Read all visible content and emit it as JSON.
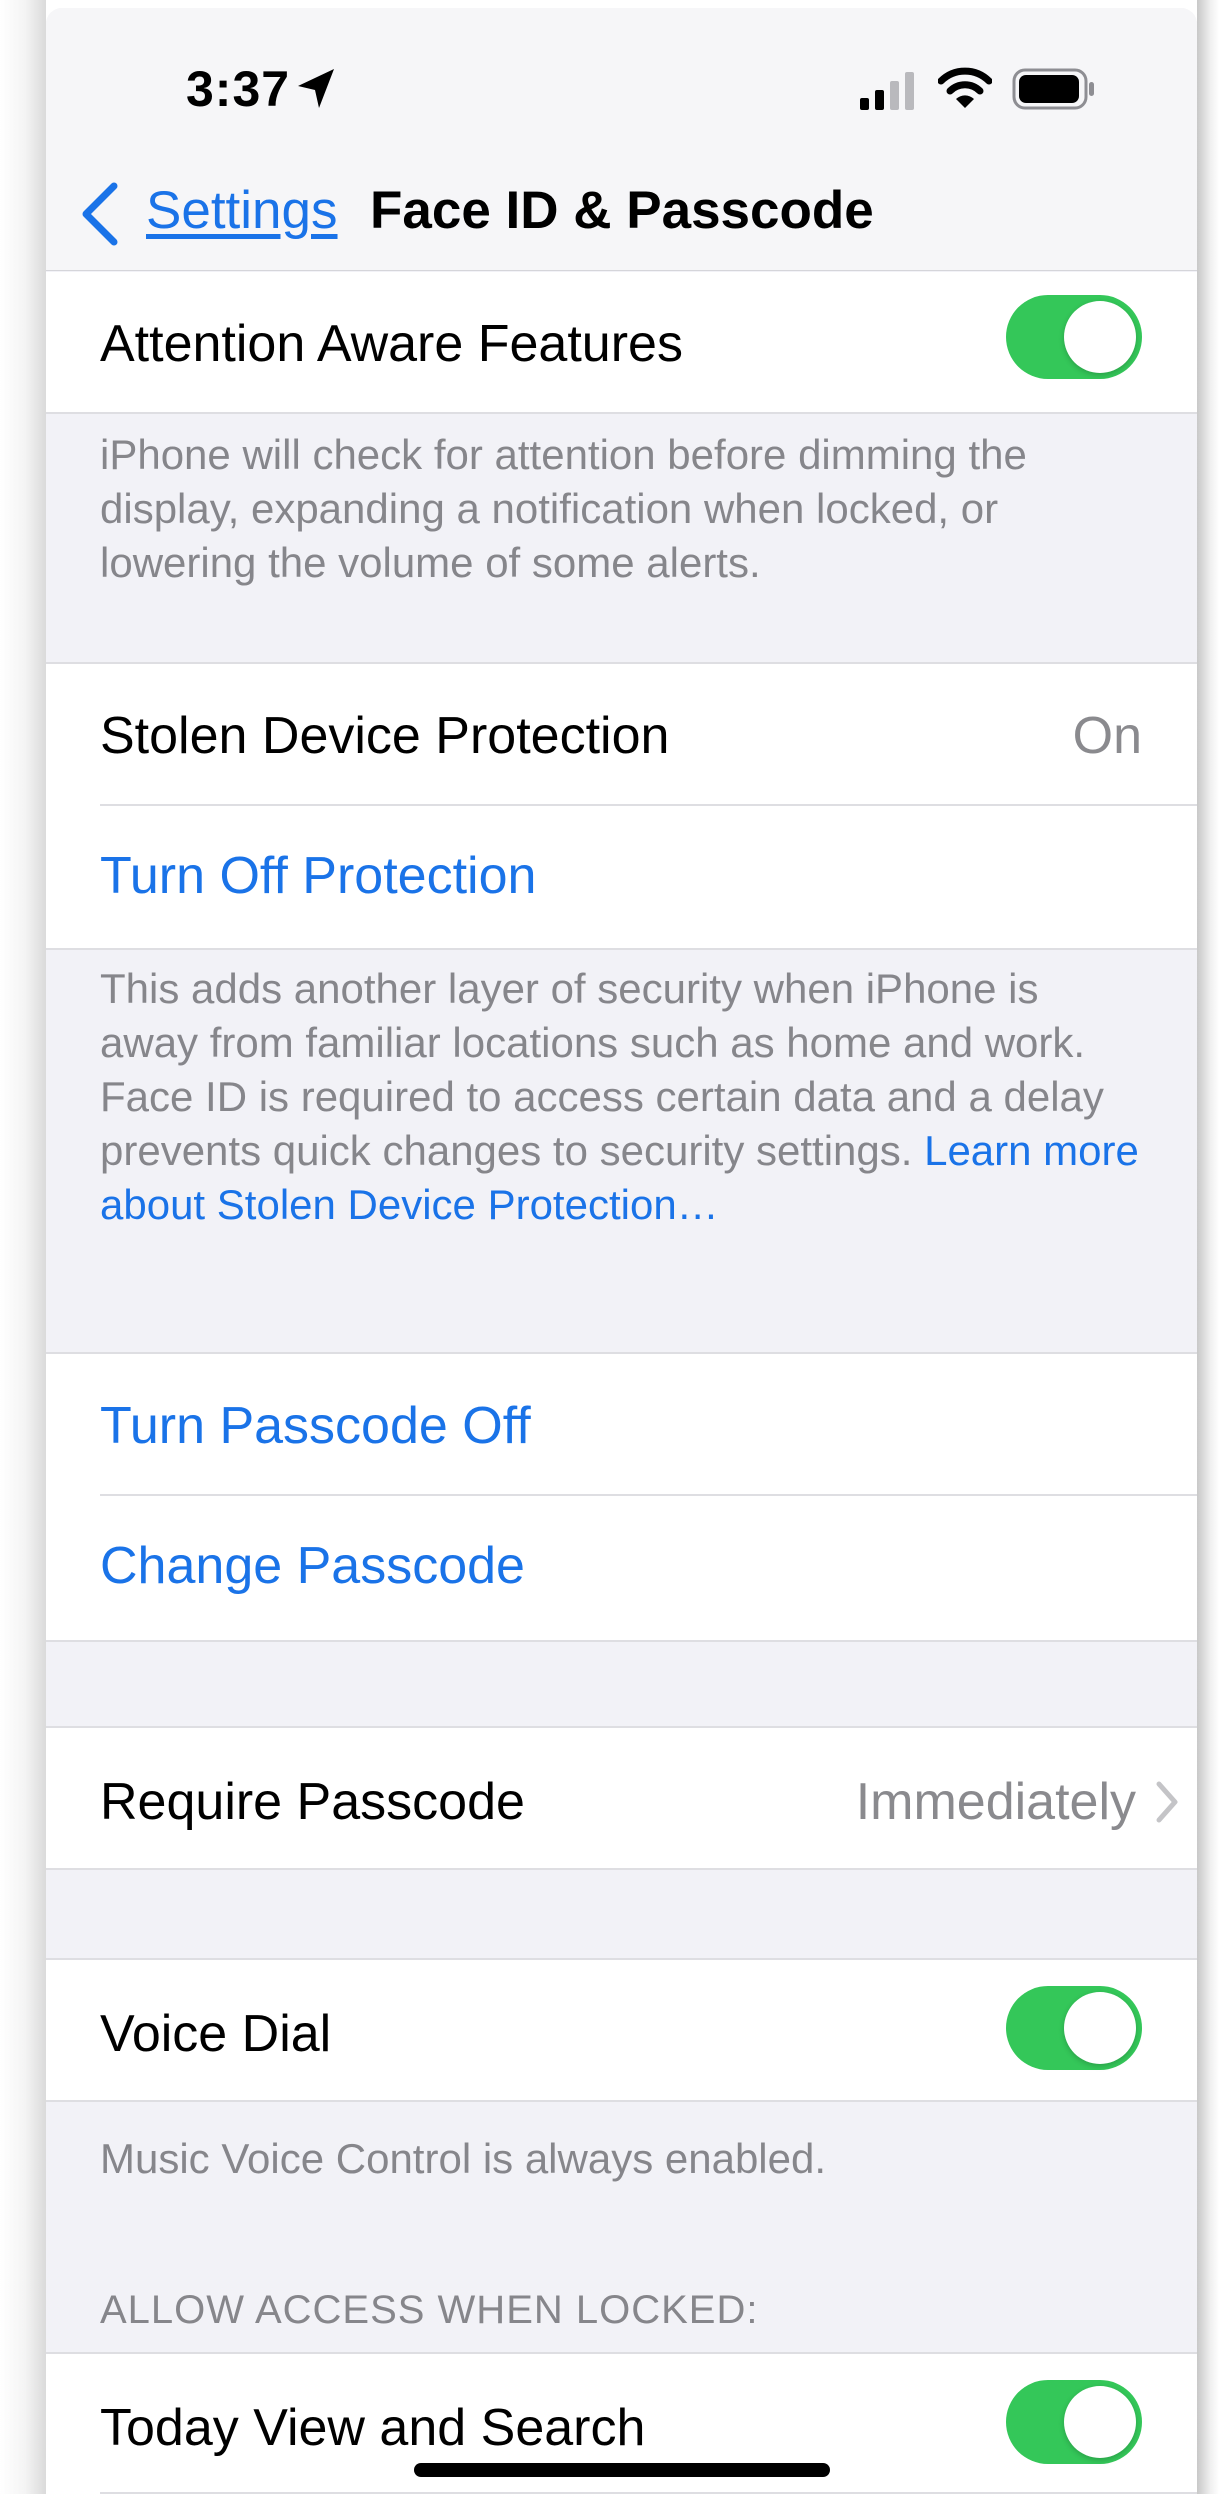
{
  "status_bar": {
    "time": "3:37"
  },
  "nav": {
    "back_label": "Settings",
    "title": "Face ID & Passcode"
  },
  "attention": {
    "label": "Attention Aware Features",
    "enabled": true,
    "footer": "iPhone will check for attention before dimming the display, expanding a notification when locked, or lowering the volume of some alerts."
  },
  "stolen_device": {
    "label": "Stolen Device Protection",
    "value": "On",
    "turn_off_label": "Turn Off Protection",
    "footer": "This adds another layer of security when iPhone is away from familiar locations such as home and work. Face ID is required to access certain data and a delay prevents quick changes to security settings.",
    "footer_link": "Learn more about Stolen Device Protection…"
  },
  "passcode": {
    "turn_off_label": "Turn Passcode Off",
    "change_label": "Change Passcode"
  },
  "require_passcode": {
    "label": "Require Passcode",
    "value": "Immediately"
  },
  "voice_dial": {
    "label": "Voice Dial",
    "enabled": true,
    "footer": "Music Voice Control is always enabled."
  },
  "locked_access": {
    "header": "ALLOW ACCESS WHEN LOCKED:",
    "today_view_label": "Today View and Search",
    "today_view_enabled": true
  },
  "colors": {
    "accent": "#1a73e8",
    "toggle_on": "#34c759",
    "background": "#f2f2f7"
  }
}
